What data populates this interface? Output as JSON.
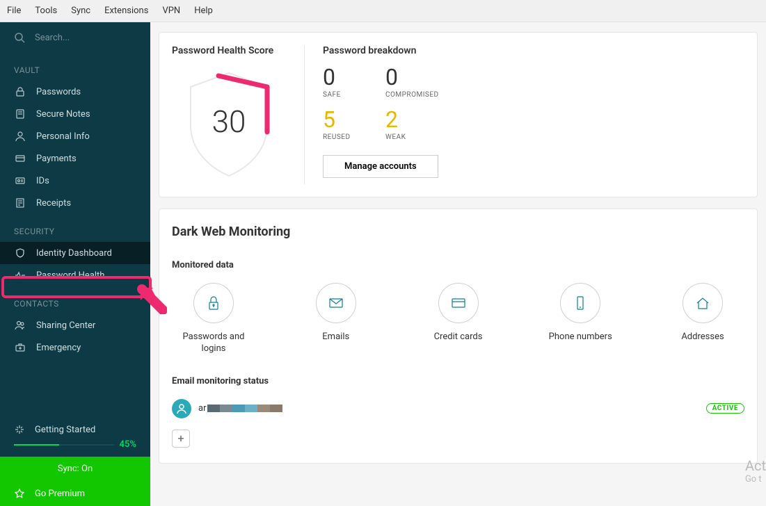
{
  "menubar": [
    "File",
    "Tools",
    "Sync",
    "Extensions",
    "VPN",
    "Help"
  ],
  "search": {
    "placeholder": "Search..."
  },
  "sections": {
    "vault": {
      "label": "VAULT",
      "items": [
        {
          "id": "passwords",
          "label": "Passwords"
        },
        {
          "id": "secure-notes",
          "label": "Secure Notes"
        },
        {
          "id": "personal-info",
          "label": "Personal Info"
        },
        {
          "id": "payments",
          "label": "Payments"
        },
        {
          "id": "ids",
          "label": "IDs"
        },
        {
          "id": "receipts",
          "label": "Receipts"
        }
      ]
    },
    "security": {
      "label": "SECURITY",
      "items": [
        {
          "id": "identity-dashboard",
          "label": "Identity Dashboard",
          "active": true
        },
        {
          "id": "password-health",
          "label": "Password Health"
        }
      ]
    },
    "contacts": {
      "label": "CONTACTS",
      "items": [
        {
          "id": "sharing-center",
          "label": "Sharing Center"
        },
        {
          "id": "emergency",
          "label": "Emergency"
        }
      ]
    }
  },
  "getting_started": {
    "label": "Getting Started",
    "percent": "45%"
  },
  "sync": {
    "label": "Sync: On"
  },
  "premium": {
    "label": "Go Premium"
  },
  "health": {
    "title": "Password Health Score",
    "score": "30",
    "breakdown_title": "Password breakdown",
    "safe": {
      "n": "0",
      "l": "SAFE"
    },
    "compromised": {
      "n": "0",
      "l": "COMPROMISED"
    },
    "reused": {
      "n": "5",
      "l": "REUSED"
    },
    "weak": {
      "n": "2",
      "l": "WEAK"
    },
    "manage": "Manage accounts"
  },
  "darkweb": {
    "title": "Dark Web Monitoring",
    "monitored_label": "Monitored data",
    "items": [
      {
        "id": "passwords-logins",
        "label": "Passwords and logins"
      },
      {
        "id": "emails",
        "label": "Emails"
      },
      {
        "id": "credit-cards",
        "label": "Credit cards"
      },
      {
        "id": "phone-numbers",
        "label": "Phone numbers"
      },
      {
        "id": "addresses",
        "label": "Addresses"
      }
    ],
    "email_status_label": "Email monitoring status",
    "email_prefix": "ar",
    "active_label": "ACTIVE"
  },
  "watermark": {
    "l1": "Act",
    "l2": "Go t"
  }
}
